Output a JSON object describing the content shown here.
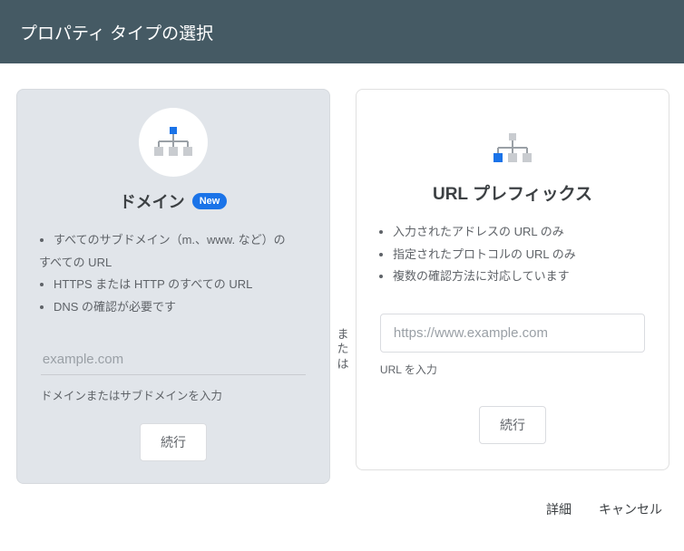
{
  "header": {
    "title": "プロパティ タイプの選択"
  },
  "divider": "または",
  "domain_card": {
    "title": "ドメイン",
    "badge": "New",
    "bullets": [
      "すべてのサブドメイン（m.、www. など）の",
      "すべての URL",
      "HTTPS または HTTP のすべての URL",
      "DNS の確認が必要です"
    ],
    "placeholder": "example.com",
    "helper": "ドメインまたはサブドメインを入力",
    "button": "続行"
  },
  "url_card": {
    "title": "URL プレフィックス",
    "bullets": [
      "入力されたアドレスの URL のみ",
      "指定されたプロトコルの URL のみ",
      "複数の確認方法に対応しています"
    ],
    "placeholder": "https://www.example.com",
    "helper": "URL を入力",
    "button": "続行"
  },
  "footer": {
    "details": "詳細",
    "cancel": "キャンセル"
  }
}
